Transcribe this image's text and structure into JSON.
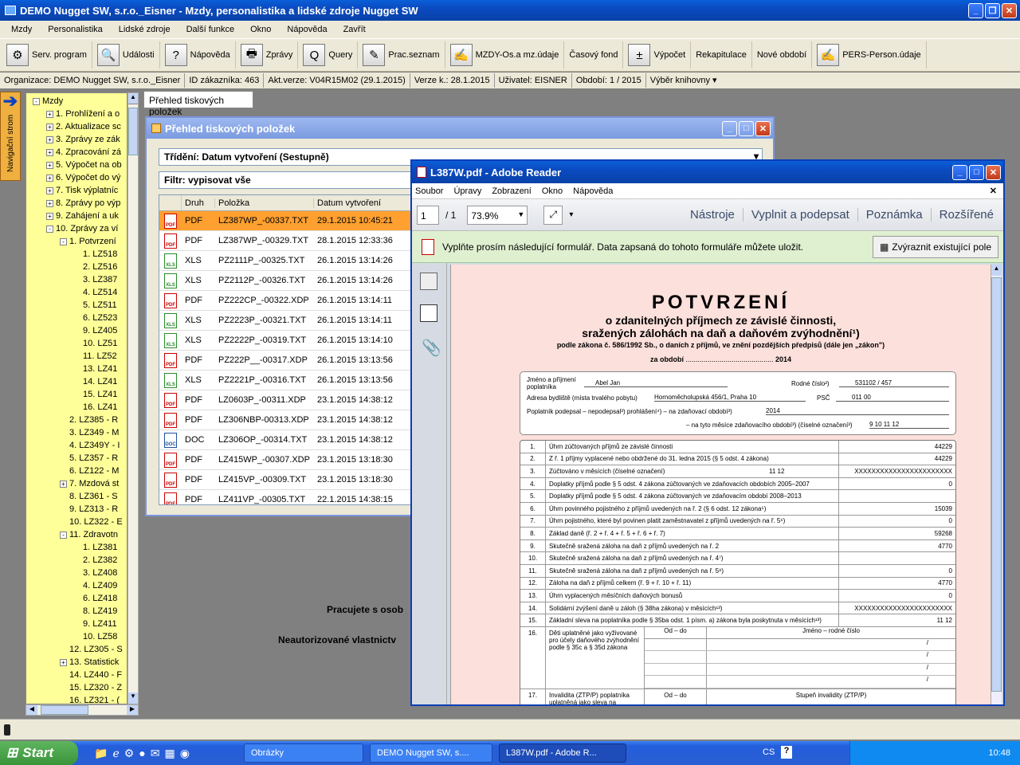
{
  "app": {
    "title": "DEMO Nugget SW, s.r.o._Eisner - Mzdy, personalistika a lidské zdroje Nugget SW",
    "menu": [
      "Mzdy",
      "Personalistika",
      "Lidské zdroje",
      "Další funkce",
      "Okno",
      "Nápověda",
      "Zavřít"
    ],
    "toolbar": [
      {
        "label": "Serv. program",
        "icon": "gear-icon",
        "glyph": "⚙"
      },
      {
        "label": "Události",
        "icon": "magnifier-icon",
        "glyph": "🔍"
      },
      {
        "label": "Nápověda",
        "icon": "help-icon",
        "glyph": "?"
      },
      {
        "label": "Zprávy",
        "icon": "printer-icon",
        "glyph": "🖶"
      },
      {
        "label": "Query",
        "icon": "query-icon",
        "glyph": "Q"
      },
      {
        "label": "Prac.seznam",
        "icon": "list-icon",
        "glyph": "✎"
      },
      {
        "label": "MZDY-Os.a mz.údaje",
        "icon": "person-icon",
        "glyph": "✍"
      },
      {
        "label": "Časový fond",
        "icon": "",
        "glyph": ""
      },
      {
        "label": "Výpočet",
        "icon": "calculator-icon",
        "glyph": "±"
      },
      {
        "label": "Rekapitulace",
        "icon": "",
        "glyph": ""
      },
      {
        "label": "Nové období",
        "icon": "",
        "glyph": ""
      },
      {
        "label": "PERS-Person.údaje",
        "icon": "person-icon",
        "glyph": "✍"
      }
    ],
    "status": [
      "Organizace: DEMO Nugget SW, s.r.o._Eisner",
      "ID zákazníka: 463",
      "Akt.verze: V04R15M02 (29.1.2015)",
      "Verze k.: 28.1.2015",
      "Uživatel: EISNER",
      "Období: 1 / 2015",
      "Výběr knihovny"
    ]
  },
  "nav": {
    "side_label": "Navigační strom",
    "tree": [
      {
        "t": "Mzdy",
        "l": 0,
        "s": "-"
      },
      {
        "t": "1. Prohlížení a o",
        "l": 1,
        "s": "+"
      },
      {
        "t": "2. Aktualizace sc",
        "l": 1,
        "s": "+"
      },
      {
        "t": "3. Zprávy ze zák",
        "l": 1,
        "s": "+"
      },
      {
        "t": "4. Zpracování zá",
        "l": 1,
        "s": "+"
      },
      {
        "t": "5. Výpočet na ob",
        "l": 1,
        "s": "+"
      },
      {
        "t": "6. Výpočet do vý",
        "l": 1,
        "s": "+"
      },
      {
        "t": "7. Tisk výplatníc",
        "l": 1,
        "s": "+"
      },
      {
        "t": "8. Zprávy po výp",
        "l": 1,
        "s": "+"
      },
      {
        "t": "9. Zahájení a uk",
        "l": 1,
        "s": "+"
      },
      {
        "t": "10. Zprávy za ví",
        "l": 1,
        "s": "-"
      },
      {
        "t": "1. Potvrzení",
        "l": 2,
        "s": "-"
      },
      {
        "t": "1. LZ518",
        "l": 3,
        "s": ""
      },
      {
        "t": "2. LZ516",
        "l": 3,
        "s": ""
      },
      {
        "t": "3. LZ387",
        "l": 3,
        "s": ""
      },
      {
        "t": "4. LZ514",
        "l": 3,
        "s": ""
      },
      {
        "t": "5. LZ511",
        "l": 3,
        "s": ""
      },
      {
        "t": "6. LZ523",
        "l": 3,
        "s": ""
      },
      {
        "t": "9. LZ405",
        "l": 3,
        "s": ""
      },
      {
        "t": "10. LZ51",
        "l": 3,
        "s": ""
      },
      {
        "t": "11. LZ52",
        "l": 3,
        "s": ""
      },
      {
        "t": "13. LZ41",
        "l": 3,
        "s": ""
      },
      {
        "t": "14. LZ41",
        "l": 3,
        "s": ""
      },
      {
        "t": "15. LZ41",
        "l": 3,
        "s": ""
      },
      {
        "t": "16. LZ41",
        "l": 3,
        "s": ""
      },
      {
        "t": "2. LZ385 - R",
        "l": 2,
        "s": ""
      },
      {
        "t": "3. LZ349 - M",
        "l": 2,
        "s": ""
      },
      {
        "t": "4. LZ349Y - I",
        "l": 2,
        "s": ""
      },
      {
        "t": "5. LZ357 - R",
        "l": 2,
        "s": ""
      },
      {
        "t": "6. LZ122 - M",
        "l": 2,
        "s": ""
      },
      {
        "t": "7. Mzdová st",
        "l": 2,
        "s": "+"
      },
      {
        "t": "8. LZ361 - S",
        "l": 2,
        "s": ""
      },
      {
        "t": "9. LZ313 - R",
        "l": 2,
        "s": ""
      },
      {
        "t": "10. LZ322 - E",
        "l": 2,
        "s": ""
      },
      {
        "t": "11. Zdravotn",
        "l": 2,
        "s": "-"
      },
      {
        "t": "1. LZ381",
        "l": 3,
        "s": ""
      },
      {
        "t": "2. LZ382",
        "l": 3,
        "s": ""
      },
      {
        "t": "3. LZ408",
        "l": 3,
        "s": ""
      },
      {
        "t": "4. LZ409",
        "l": 3,
        "s": ""
      },
      {
        "t": "6. LZ418",
        "l": 3,
        "s": ""
      },
      {
        "t": "8. LZ419",
        "l": 3,
        "s": ""
      },
      {
        "t": "9. LZ411",
        "l": 3,
        "s": ""
      },
      {
        "t": "10. LZ58",
        "l": 3,
        "s": ""
      },
      {
        "t": "12. LZ305 - S",
        "l": 2,
        "s": ""
      },
      {
        "t": "13. Statistick",
        "l": 2,
        "s": "+"
      },
      {
        "t": "14. LZ440 - F",
        "l": 2,
        "s": ""
      },
      {
        "t": "15. LZ320 - Z",
        "l": 2,
        "s": ""
      },
      {
        "t": "16. LZ321 - (",
        "l": 2,
        "s": ""
      }
    ]
  },
  "tab": {
    "label": "Přehled tiskových položek"
  },
  "print_window": {
    "title": "Přehled tiskových položek",
    "sort": "Třídění: Datum vytvoření (Sestupně)",
    "filter": "Filtr: vypisovat vše",
    "headers": [
      "Druh",
      "Položka",
      "Datum vytvoření"
    ],
    "rows": [
      {
        "type": "PDF",
        "item": "LZ387WP_-00337.TXT",
        "date": "29.1.2015 10:45:21"
      },
      {
        "type": "PDF",
        "item": "LZ387WP_-00329.TXT",
        "date": "28.1.2015 12:33:36"
      },
      {
        "type": "XLS",
        "item": "PZ2111P_-00325.TXT",
        "date": "26.1.2015 13:14:26"
      },
      {
        "type": "XLS",
        "item": "PZ2112P_-00326.TXT",
        "date": "26.1.2015 13:14:26"
      },
      {
        "type": "PDF",
        "item": "PZ222CP_-00322.XDP",
        "date": "26.1.2015 13:14:11"
      },
      {
        "type": "XLS",
        "item": "PZ2223P_-00321.TXT",
        "date": "26.1.2015 13:14:11"
      },
      {
        "type": "XLS",
        "item": "PZ2222P_-00319.TXT",
        "date": "26.1.2015 13:14:10"
      },
      {
        "type": "PDF",
        "item": "PZ222P__-00317.XDP",
        "date": "26.1.2015 13:13:56"
      },
      {
        "type": "XLS",
        "item": "PZ2221P_-00316.TXT",
        "date": "26.1.2015 13:13:56"
      },
      {
        "type": "PDF",
        "item": "LZ0603P_-00311.XDP",
        "date": "23.1.2015 14:38:12"
      },
      {
        "type": "PDF",
        "item": "LZ306NBP-00313.XDP",
        "date": "23.1.2015 14:38:12"
      },
      {
        "type": "DOC",
        "item": "LZ306OP_-00314.TXT",
        "date": "23.1.2015 14:38:12"
      },
      {
        "type": "PDF",
        "item": "LZ415WP_-00307.XDP",
        "date": "23.1.2015 13:18:30"
      },
      {
        "type": "PDF",
        "item": "LZ415VP_-00309.TXT",
        "date": "23.1.2015 13:18:30"
      },
      {
        "type": "PDF",
        "item": "LZ411VP_-00305.TXT",
        "date": "22.1.2015 14:38:15"
      }
    ]
  },
  "background_text": {
    "line1": "Pracujete s osob",
    "line2": "Neautorizované vlastnictv"
  },
  "reader": {
    "title": "L387W.pdf - Adobe Reader",
    "menu": [
      "Soubor",
      "Úpravy",
      "Zobrazení",
      "Okno",
      "Nápověda"
    ],
    "page": "1",
    "pages": "/ 1",
    "zoom": "73.9%",
    "actions": [
      "Nástroje",
      "Vyplnit a podepsat",
      "Poznámka",
      "Rozšířené"
    ],
    "form_msg": "Vyplňte prosím následující formulář. Data zapsaná do tohoto formuláře můžete uložit.",
    "highlight_btn": "Zvýraznit existující pole"
  },
  "doc": {
    "title": "POTVRZENÍ",
    "sub1": "o zdanitelných příjmech ze závislé činnosti,",
    "sub2": "sražených zálohách na daň a daňovém zvýhodnění¹)",
    "law": "podle zákona č. 586/1992 Sb., o daních z příjmů, ve znění pozdějších předpisů (dále jen „zákon\")",
    "period_label": "za období",
    "period_dots": "............................................",
    "year": "2014",
    "name_label": "Jméno a příjmení poplatníka",
    "name": "Abel Jan",
    "rc_label": "Rodné číslo²)",
    "rc": "531102  /  457",
    "addr_label": "Adresa bydliště (místa trvalého pobytu)",
    "addr": "Hornoměcholupská 456/1, Praha 10",
    "psc_label": "PSČ",
    "psc": "011 00",
    "signed_label": "Poplatník podepsal – nepodepsal³) prohlášení⁴) – na zdaňovací období³)",
    "signed_year": "2014",
    "months_label": "– na tyto měsíce zdaňovacího období³) (číselné označení³)",
    "months": "9 10 11 12",
    "rows": [
      {
        "n": "1.",
        "d": "Úhrn zúčtovaných příjmů ze závislé činnosti",
        "v": "44229"
      },
      {
        "n": "2.",
        "d": "Z ř. 1 příjmy vyplacené nebo obdržené do 31. ledna 2015 (§ 5 odst. 4 zákona)",
        "v": "44229"
      },
      {
        "n": "3.",
        "d": "Zúčtováno v měsících (číselné označení)",
        "mid": "11 12",
        "v": "XXXXXXXXXXXXXXXXXXXXXXX"
      },
      {
        "n": "4.",
        "d": "Doplatky příjmů podle § 5 odst. 4 zákona zúčtovaných ve zdaňovacích obdobích 2005–2007",
        "v": "0"
      },
      {
        "n": "5.",
        "d": "Doplatky příjmů podle § 5 odst. 4 zákona zúčtovaných ve zdaňovacím období 2008–2013",
        "v": ""
      },
      {
        "n": "6.",
        "d": "Úhrn povinného pojistného z příjmů uvedených na ř. 2 (§ 6 odst. 12 zákona⁵)",
        "v": "15039"
      },
      {
        "n": "7.",
        "d": "Úhrn pojistného, které byl povinen platit zaměstnavatel z příjmů uvedených na ř. 5⁶)",
        "v": "0"
      },
      {
        "n": "8.",
        "d": "Základ daně (ř. 2 + ř. 4 + ř. 5 + ř. 6 + ř. 7)",
        "v": "59268"
      },
      {
        "n": "9.",
        "d": "Skutečně sražená záloha na daň z příjmů uvedených na ř. 2",
        "v": "4770"
      },
      {
        "n": "10.",
        "d": "Skutečně sražená záloha na daň z příjmů uvedených na ř. 4⁷)",
        "v": ""
      },
      {
        "n": "11.",
        "d": "Skutečně sražená záloha na daň z příjmů uvedených na ř. 5⁸)",
        "v": "0"
      },
      {
        "n": "12.",
        "d": "Záloha na daň z příjmů celkem (ř. 9 + ř. 10 + ř. 11)",
        "v": "4770"
      },
      {
        "n": "13.",
        "d": "Úhrn vyplacených měsíčních daňových bonusů",
        "v": "0"
      },
      {
        "n": "14.",
        "d": "Solidární zvýšení daně u záloh (§ 38ha zákona) v měsících¹³)",
        "v": "XXXXXXXXXXXXXXXXXXXXXXX"
      },
      {
        "n": "15.",
        "d": "Základní sleva na poplatníka podle § 35ba odst. 1 písm. a) zákona byla poskytnuta v měsících¹³)",
        "v": "11 12"
      }
    ],
    "r16_n": "16.",
    "r16_d": "Děti uplatněné jako vyživované pro účely daňového zvýhodnění podle § 35c a § 35d zákona",
    "r16_h1": "Od – do",
    "r16_h2": "Jméno – rodné číslo",
    "slash": "/",
    "r17_n": "17.",
    "r17_d": "Invalidita (ZTP/P) poplatníka uplatněná jako sleva na",
    "r17_h1": "Od – do",
    "r17_h2": "Stupeň invalidity (ZTP/P)"
  },
  "taskbar": {
    "start": "Start",
    "tasks": [
      "Obrázky",
      "DEMO Nugget SW, s....",
      "L387W.pdf - Adobe R..."
    ],
    "lang": "CS",
    "clock": "10:48"
  },
  "colors": {
    "xp_blue": "#0b4ac0",
    "tree_yellow": "#ffff99",
    "selected_row": "#ffa030",
    "form_pink": "#fce0dc",
    "form_green": "#dff0d0"
  }
}
